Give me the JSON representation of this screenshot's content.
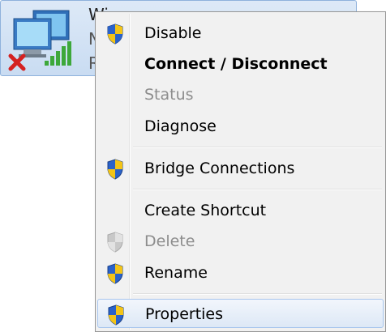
{
  "adapter": {
    "line1": "Wi",
    "line2": "N",
    "line3": "R"
  },
  "menu": {
    "items": [
      {
        "label": "Disable"
      },
      {
        "label": "Connect / Disconnect"
      },
      {
        "label": "Status"
      },
      {
        "label": "Diagnose"
      },
      {
        "label": "Bridge Connections"
      },
      {
        "label": "Create Shortcut"
      },
      {
        "label": "Delete"
      },
      {
        "label": "Rename"
      },
      {
        "label": "Properties"
      }
    ]
  },
  "colors": {
    "highlight_border": "#a8c6ee",
    "disabled_text": "#8d8d8d",
    "shield_blue": "#2a62c9",
    "shield_yellow": "#f3c417"
  }
}
